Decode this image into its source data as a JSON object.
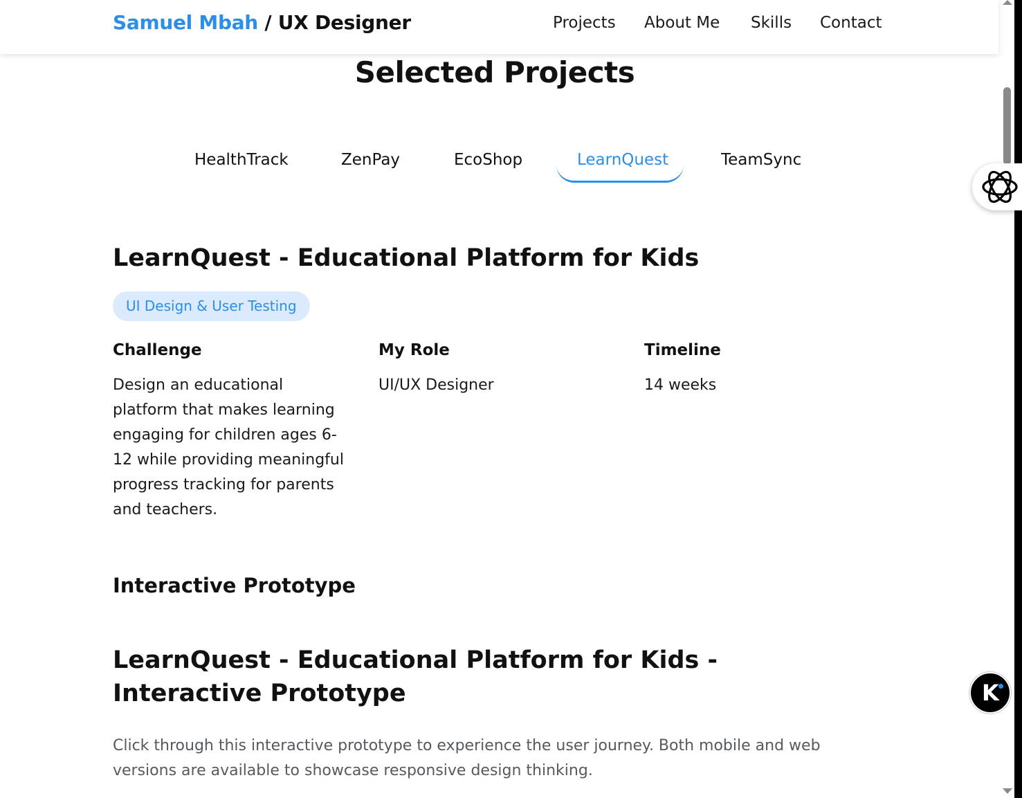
{
  "header": {
    "name": "Samuel Mbah",
    "separator": " / ",
    "role": "UX Designer",
    "nav": [
      "Projects",
      "About Me",
      "Skills",
      "Contact"
    ]
  },
  "section": {
    "title": "Selected Projects",
    "tabs": [
      "HealthTrack",
      "ZenPay",
      "EcoShop",
      "LearnQuest",
      "TeamSync"
    ],
    "active_tab": "LearnQuest"
  },
  "project": {
    "title": "LearnQuest - Educational Platform for Kids",
    "tag": "UI Design & User Testing",
    "challenge": {
      "heading": "Challenge",
      "text": "Design an educational platform that makes learning engaging for children ages 6-12 while providing meaningful progress tracking for parents and teachers."
    },
    "role": {
      "heading": "My Role",
      "text": "UI/UX Designer"
    },
    "timeline": {
      "heading": "Timeline",
      "text": "14 weeks"
    },
    "prototype_heading": "Interactive Prototype",
    "prototype_title": "LearnQuest - Educational Platform for Kids - Interactive Prototype",
    "prototype_desc": "Click through this interactive prototype to experience the user journey. Both mobile and web versions are available to showcase responsive design thinking."
  },
  "widgets": {
    "ai_icon": "openai-knot-icon",
    "k_badge": "K"
  },
  "colors": {
    "accent": "#2b8ee8",
    "pill_bg": "#dbeafc",
    "muted_text": "#555a60"
  }
}
